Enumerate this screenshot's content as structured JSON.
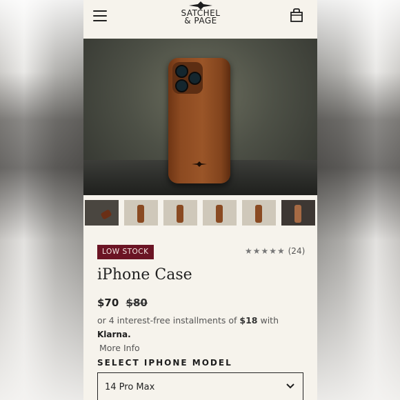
{
  "header": {
    "logo_line1": "SATCHEL",
    "logo_line2": "& PAGE"
  },
  "product": {
    "badge": "LOW STOCK",
    "rating_stars": "★★★★★",
    "rating_count": "(24)",
    "title": "iPhone Case",
    "price": "$70",
    "original_price": "$80",
    "installments_text": "or 4 interest-free installments of",
    "installment_amount": "$18",
    "with_text": "with",
    "klarna_label": "Klarna.",
    "more_info": "More Info"
  },
  "model_select": {
    "label": "SELECT IPHONE MODEL",
    "selected": "14 Pro Max"
  },
  "colors": {
    "background": "#f6f3ec",
    "badge": "#6b1424",
    "leather": "#8c4a21"
  },
  "icons": {
    "menu": "hamburger-icon",
    "cart": "shopping-bag-icon",
    "dropdown": "chevron-down-icon"
  }
}
